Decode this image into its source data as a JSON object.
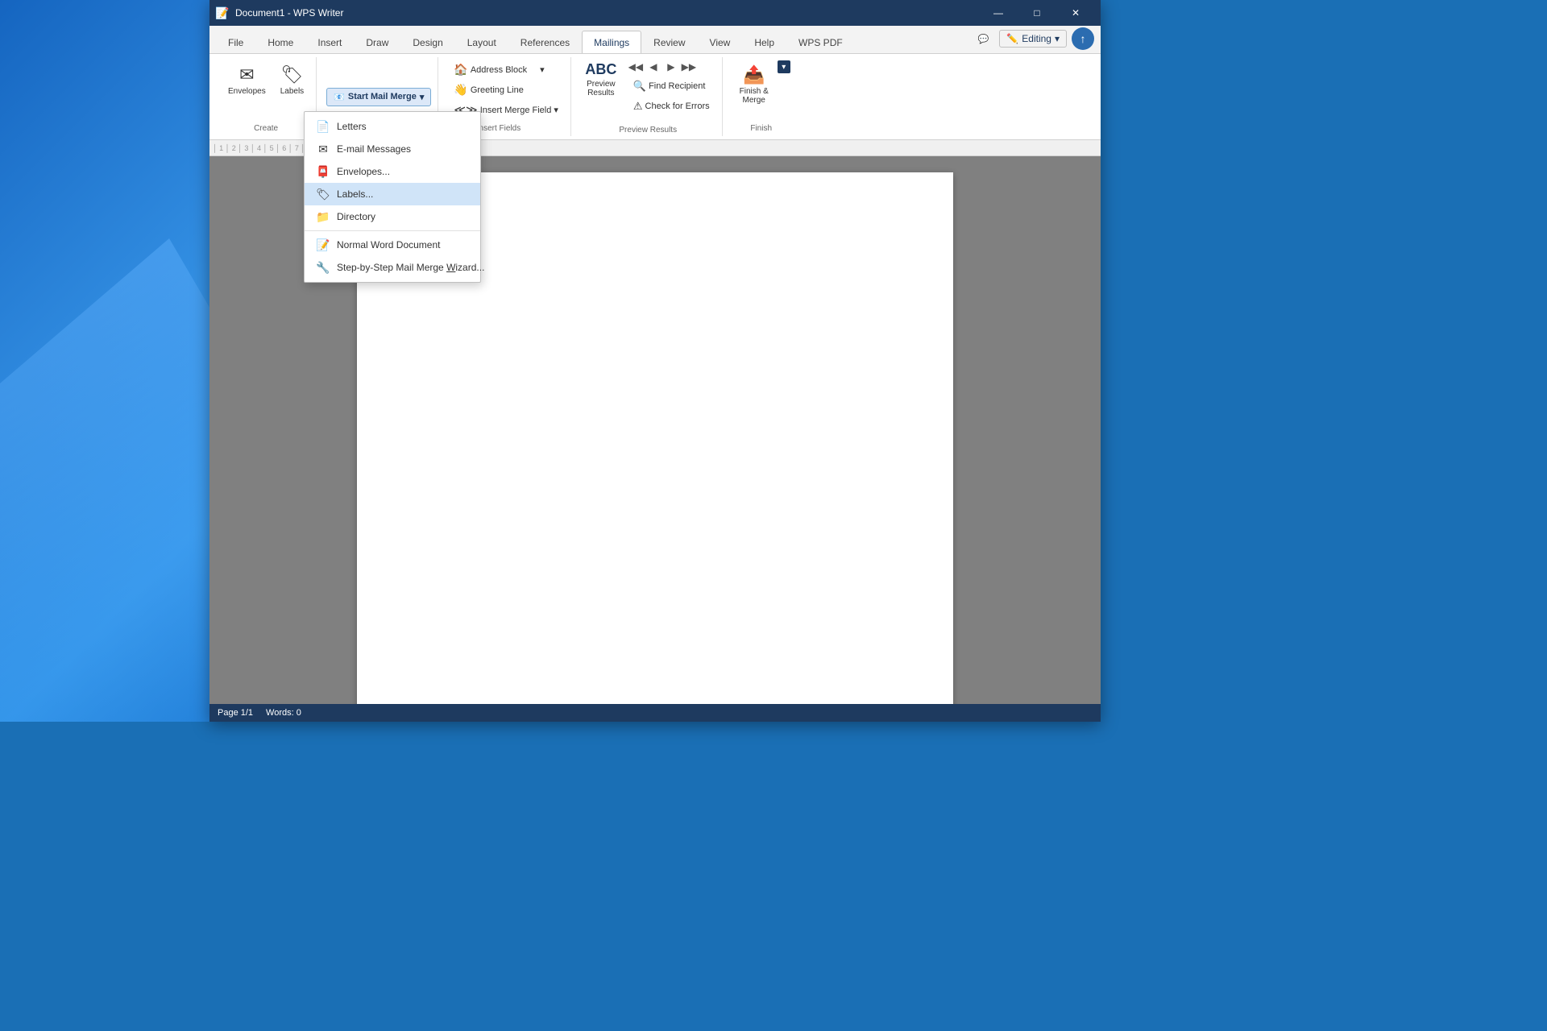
{
  "window": {
    "title": "Document1 - WPS Writer",
    "min_label": "—",
    "max_label": "□",
    "close_label": "✕"
  },
  "tabs": [
    {
      "label": "File",
      "active": false
    },
    {
      "label": "Home",
      "active": false
    },
    {
      "label": "Insert",
      "active": false
    },
    {
      "label": "Draw",
      "active": false
    },
    {
      "label": "Design",
      "active": false
    },
    {
      "label": "Layout",
      "active": false
    },
    {
      "label": "References",
      "active": false
    },
    {
      "label": "Mailings",
      "active": true
    },
    {
      "label": "Review",
      "active": false
    },
    {
      "label": "View",
      "active": false
    },
    {
      "label": "Help",
      "active": false
    },
    {
      "label": "WPS PDF",
      "active": false
    }
  ],
  "editing_btn": {
    "icon": "✏️",
    "label": "Editing",
    "chevron": "▾"
  },
  "ribbon": {
    "create_group": {
      "label": "Create",
      "envelopes_btn": "Envelopes",
      "labels_btn": "Labels"
    },
    "start_merge": {
      "icon": "📧",
      "label": "Start Mail Merge",
      "chevron": "▾"
    },
    "write_insert": {
      "label": "Write & Insert Fields",
      "address_block_btn": "Address Block",
      "greeting_line_btn": "Greeting Line",
      "insert_merge_field_btn": "Insert Merge Field"
    },
    "preview_results": {
      "label": "Preview Results",
      "preview_btn_icon": "ABC",
      "preview_btn_text": "Preview\nResults",
      "prev_btn": "◀",
      "next_btn": "▶",
      "first_btn": "◀◀",
      "last_btn": "▶▶",
      "find_recipient_btn": "Find Recipient",
      "check_errors_btn": "Check for Errors"
    },
    "finish": {
      "label": "Finish",
      "finish_btn": "Finish &\nMerge"
    }
  },
  "dropdown": {
    "items": [
      {
        "label": "Letters",
        "icon": "📄",
        "underline_char": "L"
      },
      {
        "label": "E-mail Messages",
        "icon": "✉️",
        "underline_char": "E"
      },
      {
        "label": "Envelopes...",
        "icon": "📮",
        "underline_char": "v"
      },
      {
        "label": "Labels...",
        "icon": "🏷️",
        "underline_char": "b",
        "highlighted": true
      },
      {
        "label": "Directory",
        "icon": "📁",
        "underline_char": "D"
      },
      {
        "separator": true
      },
      {
        "label": "Normal Word Document",
        "icon": "📝",
        "underline_char": "N"
      },
      {
        "label": "Step-by-Step Mail Merge Wizard...",
        "icon": "🔧",
        "underline_char": "W"
      }
    ]
  },
  "status_bar": {
    "words": "Words: 0",
    "page": "Page 1/1"
  }
}
